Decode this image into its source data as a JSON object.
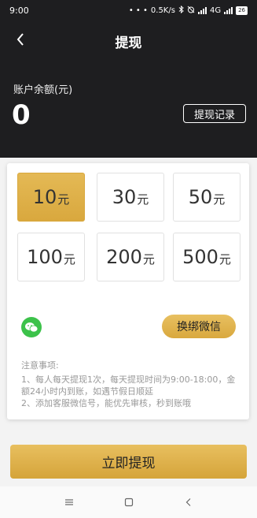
{
  "status_bar": {
    "time": "9:00",
    "dots": "• • •",
    "network_speed": "0.5K/s",
    "network_type": "4G",
    "battery": "26"
  },
  "header": {
    "title": "提现",
    "balance_label": "账户余额(元)",
    "balance_value": "0",
    "record_button": "提现记录"
  },
  "amounts": [
    {
      "num": "10",
      "unit": "元",
      "selected": true
    },
    {
      "num": "30",
      "unit": "元",
      "selected": false
    },
    {
      "num": "50",
      "unit": "元",
      "selected": false
    },
    {
      "num": "100",
      "unit": "元",
      "selected": false
    },
    {
      "num": "200",
      "unit": "元",
      "selected": false
    },
    {
      "num": "500",
      "unit": "元",
      "selected": false
    }
  ],
  "bind": {
    "button_label": "换绑微信",
    "icon": "wechat-icon"
  },
  "notes": {
    "title": "注意事项:",
    "items": [
      "1、每人每天提现1次，每天提现时间为9:00-18:00，金额24小时内到账，如遇节假日顺延",
      "2、添加客服微信号，能优先审核，秒到账哦"
    ]
  },
  "submit_label": "立即提现",
  "colors": {
    "header_bg": "#1e1e20",
    "gold": "#d9a83e",
    "wechat_green": "#3cc24a"
  }
}
